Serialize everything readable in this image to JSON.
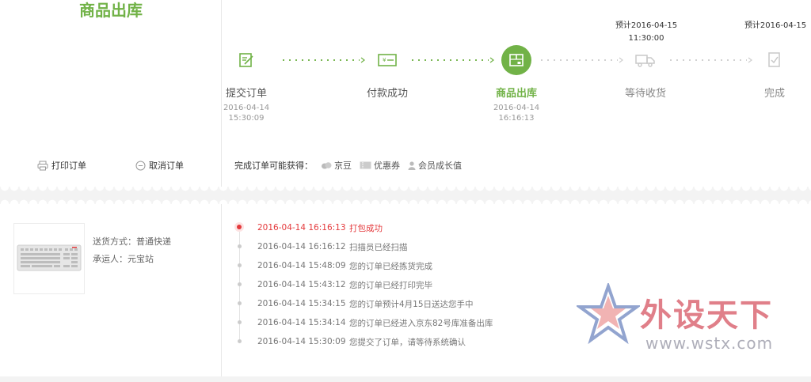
{
  "status_title": "商品出库",
  "actions": {
    "print_label": "打印订单",
    "cancel_label": "取消订单"
  },
  "steps": [
    {
      "label": "提交订单",
      "date": "2016-04-14",
      "time": "15:30:09",
      "state": "done",
      "icon": "edit-doc-icon"
    },
    {
      "label": "付款成功",
      "date": "",
      "time": "",
      "state": "done",
      "icon": "payment-card-icon"
    },
    {
      "label": "商品出库",
      "date": "2016-04-14",
      "time": "16:16:13",
      "state": "active",
      "icon": "package-icon"
    },
    {
      "label": "等待收货",
      "date": "",
      "time": "",
      "state": "pending",
      "icon": "truck-icon"
    },
    {
      "label": "完成",
      "date": "",
      "time": "",
      "state": "pending",
      "icon": "check-doc-icon"
    }
  ],
  "eta": [
    {
      "label": "预计2016-04-15",
      "time": "11:30:00"
    },
    {
      "label": "预计2016-04-15",
      "time": ""
    }
  ],
  "bonus": {
    "label": "完成订单可能获得：",
    "items": [
      "京豆",
      "优惠券",
      "会员成长值"
    ]
  },
  "shipping": {
    "method": "送货方式：普通快递",
    "carrier": "承运人：元宝站"
  },
  "timeline": [
    {
      "time": "2016-04-14 16:16:13",
      "text": "打包成功"
    },
    {
      "time": "2016-04-14 16:16:12",
      "text": "扫描员已经扫描"
    },
    {
      "time": "2016-04-14 15:48:09",
      "text": "您的订单已经拣货完成"
    },
    {
      "time": "2016-04-14 15:43:12",
      "text": "您的订单已经打印完毕"
    },
    {
      "time": "2016-04-14 15:34:15",
      "text": "您的订单预计4月15日送达您手中"
    },
    {
      "time": "2016-04-14 15:34:14",
      "text": "您的订单已经进入京东82号库准备出库"
    },
    {
      "time": "2016-04-14 15:30:09",
      "text": "您提交了订单，请等待系统确认"
    }
  ],
  "watermark": {
    "text": "外设天下",
    "url": "www.wstx.com"
  },
  "colors": {
    "accent_green": "#71b247",
    "highlight_red": "#e4393c",
    "pending_gray": "#c8c8c8"
  }
}
